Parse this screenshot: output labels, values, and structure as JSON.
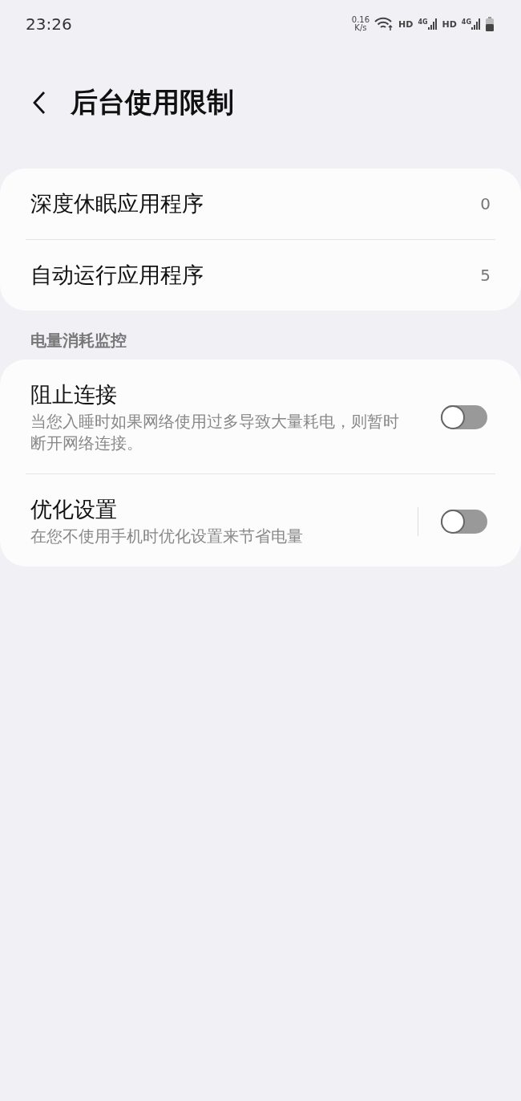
{
  "status_bar": {
    "time": "23:26",
    "speed": "0.16",
    "speed_unit": "K/s",
    "networks": [
      {
        "hd": "HD",
        "gen": "4G"
      },
      {
        "hd": "HD",
        "gen": "4G"
      }
    ]
  },
  "header": {
    "title": "后台使用限制"
  },
  "apps_card": [
    {
      "label": "深度休眠应用程序",
      "count": "0"
    },
    {
      "label": "自动运行应用程序",
      "count": "5"
    }
  ],
  "section_title": "电量消耗监控",
  "settings": [
    {
      "title": "阻止连接",
      "description": "当您入睡时如果网络使用过多导致大量耗电，则暂时断开网络连接。",
      "on": false,
      "divider": false
    },
    {
      "title": "优化设置",
      "description": "在您不使用手机时优化设置来节省电量",
      "on": false,
      "divider": true
    }
  ]
}
